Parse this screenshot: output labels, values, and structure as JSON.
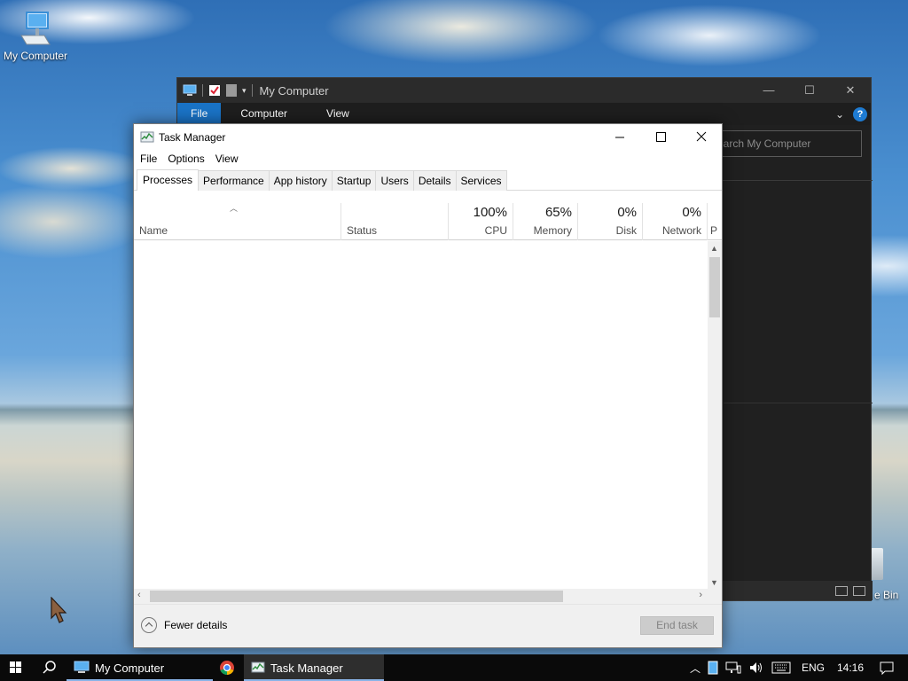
{
  "desktop": {
    "icons": [
      {
        "label": "My Computer"
      }
    ],
    "recycle_bin_partial_label": "e Bin"
  },
  "explorer": {
    "title": "My Computer",
    "ribbon_tabs": [
      "File",
      "Computer",
      "View"
    ],
    "search_placeholder": "earch My Computer",
    "help_label": "?",
    "controls": {
      "minimize": "—",
      "maximize": "☐",
      "close": "✕"
    }
  },
  "task_manager": {
    "title": "Task Manager",
    "menu": [
      "File",
      "Options",
      "View"
    ],
    "tabs": [
      "Processes",
      "Performance",
      "App history",
      "Startup",
      "Users",
      "Details",
      "Services"
    ],
    "active_tab": "Processes",
    "columns": {
      "name": "Name",
      "status": "Status",
      "cpu": {
        "value": "100%",
        "label": "CPU"
      },
      "memory": {
        "value": "65%",
        "label": "Memory"
      },
      "disk": {
        "value": "0%",
        "label": "Disk"
      },
      "network": {
        "value": "0%",
        "label": "Network"
      },
      "power_partial": "P"
    },
    "fewer_details": "Fewer details",
    "end_task": "End task"
  },
  "taskbar": {
    "tasks": [
      {
        "label": "My Computer"
      },
      {
        "label": ""
      },
      {
        "label": "Task Manager"
      }
    ],
    "language": "ENG",
    "time": "14:16"
  },
  "colors": {
    "accent": "#1a73c6",
    "taskbar": "#0a0a0a",
    "explorer_bg": "#202020"
  }
}
